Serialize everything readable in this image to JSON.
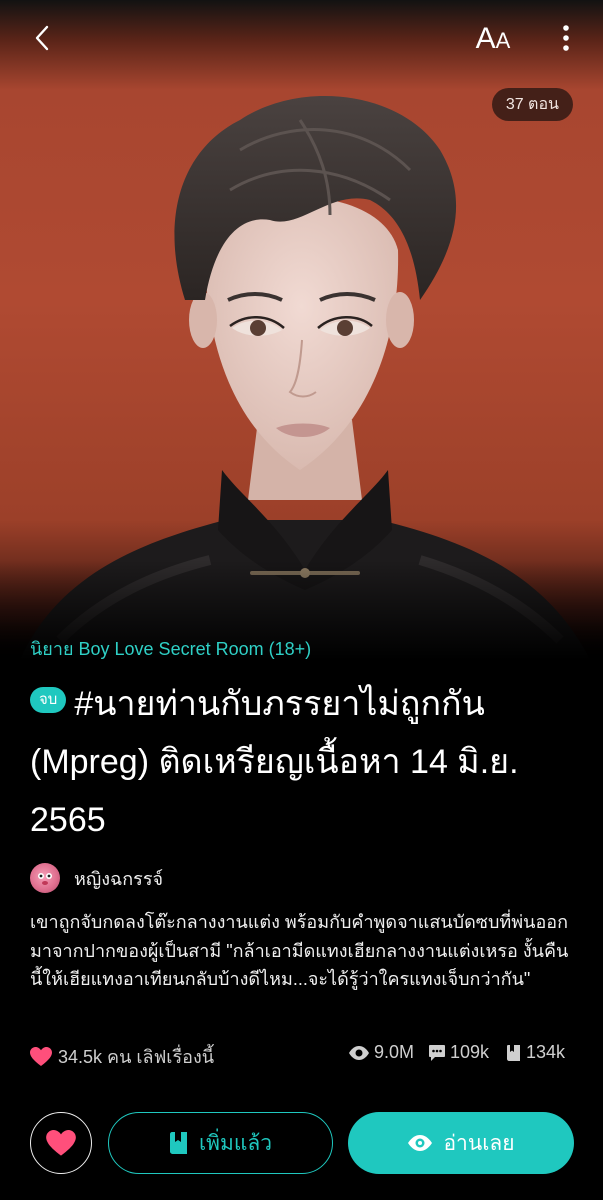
{
  "header": {
    "back_icon": "chevron-left-icon",
    "font_size_label_big": "A",
    "font_size_label_small": "A",
    "more_icon": "vertical-dots-icon"
  },
  "cover": {
    "episode_count": "37 ตอน",
    "background_color": "#b04a32"
  },
  "novel": {
    "genre": "นิยาย Boy Love Secret Room  (18+)",
    "status_badge": "จบ",
    "title": "#นายท่านกับภรรยาไม่ถูกกัน (Mpreg) ติดเหรียญเนื้อหา 14 มิ.ย. 2565",
    "author": "หญิงฉกรรจ์",
    "synopsis": "เขาถูกจับกดลงโต๊ะกลางงานแต่ง พร้อมกับคำพูดจาแสนบัดซบที่พ่นออกมาจากปากของผู้เป็นสามี \"กล้าเอามีดแทงเฮียกลางงานแต่งเหรอ งั้นคืนนี้ให้เฮียแทงอาเทียนกลับบ้างดีไหม...จะได้รู้ว่าใครแทงเจ็บกว่ากัน\""
  },
  "stats": {
    "likes": "34.5k คน เลิฟเรื่องนี้",
    "views": "9.0M",
    "comments": "109k",
    "bookmarks": "134k"
  },
  "actions": {
    "added_label": "เพิ่มแล้ว",
    "read_label": "อ่านเลย"
  },
  "colors": {
    "accent": "#1fc8bf",
    "heart": "#ff4f7b"
  }
}
